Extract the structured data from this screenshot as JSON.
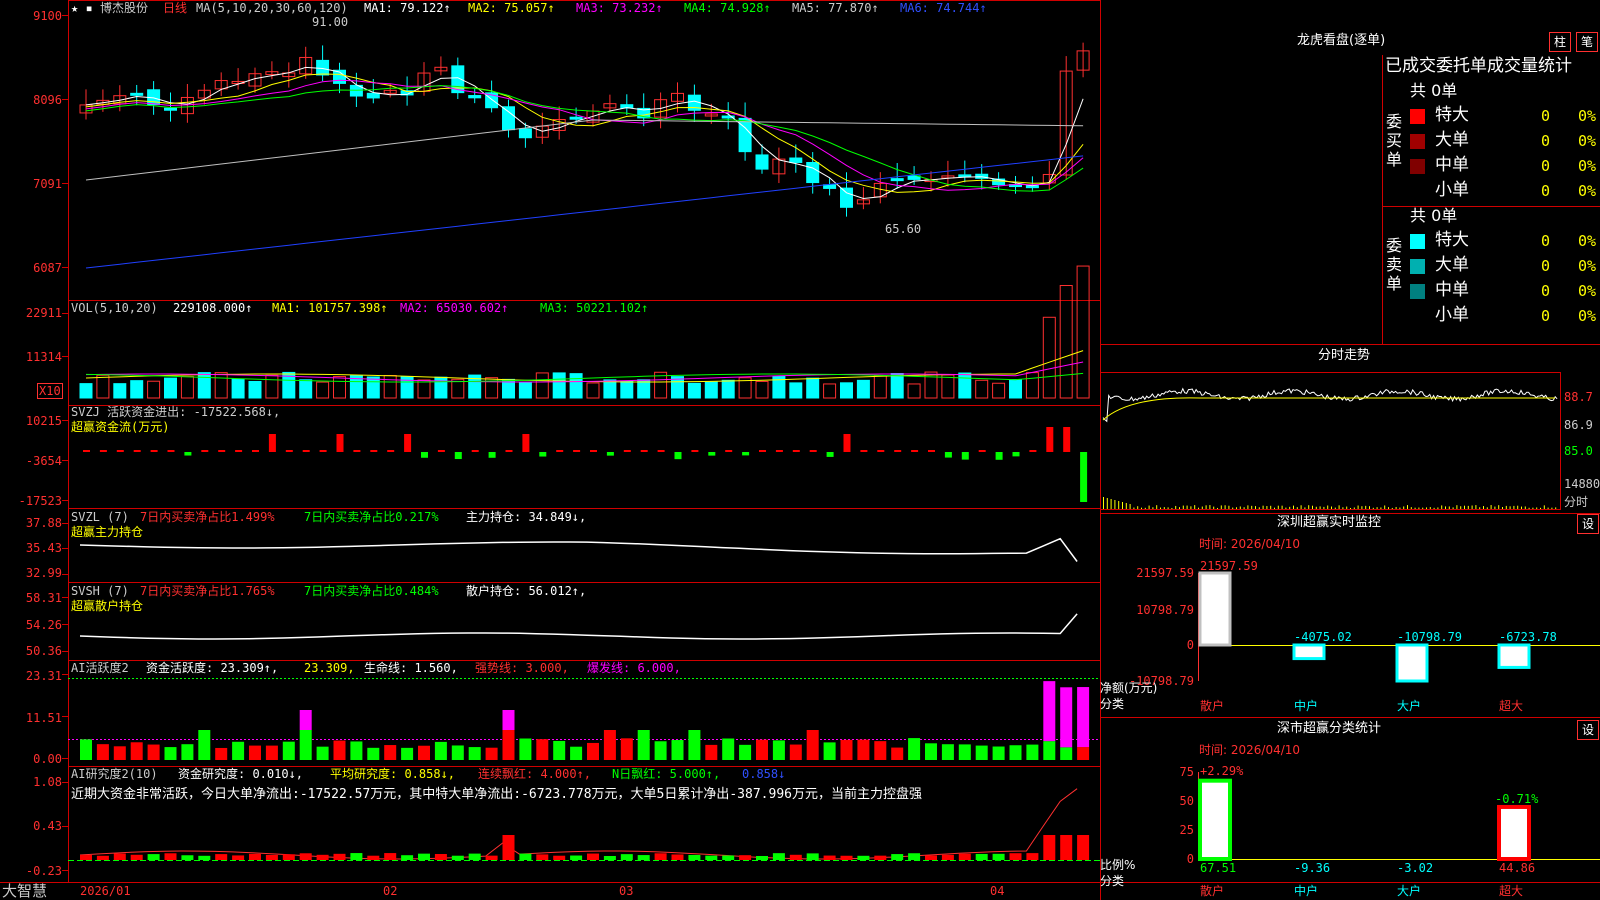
{
  "app": {
    "brand": "大智慧",
    "xlabels": [
      "2026/01",
      "02",
      "03",
      "04"
    ]
  },
  "main": {
    "stock": "博杰股份",
    "period": "日线",
    "ma_label": "MA(5,10,20,30,60,120)",
    "ma_values": [
      "MA1: 79.122↑",
      "MA2: 75.057↑",
      "MA3: 73.232↑",
      "MA4: 74.928↑",
      "MA5: 77.870↑",
      "MA6: 74.744↑"
    ],
    "y_ticks": [
      "9100",
      "8096",
      "7091",
      "6087"
    ],
    "high_mark": "91.00",
    "low_mark": "65.60"
  },
  "vol": {
    "label": "VOL(5,10,20)",
    "value": "229108.000↑",
    "mas": [
      "MA1: 101757.398↑",
      "MA2: 65030.602↑",
      "MA3: 50221.102↑"
    ],
    "y_ticks": [
      "22911",
      "11314"
    ],
    "unit": "X10"
  },
  "svzj": {
    "label": "SVZJ  活跃资金进出: -17522.568↓,",
    "sub": "超赢资金流(万元)",
    "y_ticks": [
      "10215",
      "-3654",
      "-17523"
    ]
  },
  "svzl": {
    "label": "SVZL (7)",
    "a": "7日内买卖净占比1.499%",
    "b": "7日内买卖净占比0.217%",
    "c": "主力持仓: 34.849↓,",
    "sub": "超赢主力持仓",
    "y_ticks": [
      "37.88",
      "35.43",
      "32.99"
    ]
  },
  "svsh": {
    "label": "SVSH (7)",
    "a": "7日内买卖净占比1.765%",
    "b": "7日内买卖净占比0.484%",
    "c": "散户持仓: 56.012↑,",
    "sub": "超赢散户持仓",
    "y_ticks": [
      "58.31",
      "54.26",
      "50.36"
    ]
  },
  "ai1": {
    "label": "AI活跃度2",
    "a": "资金活跃度: 23.309↑,",
    "b": "23.309,",
    "c": "生命线: 1.560,",
    "d": "强势线: 3.000,",
    "e": "爆发线: 6.000,",
    "y_ticks": [
      "23.31",
      "11.51",
      "0.00"
    ]
  },
  "ai2": {
    "label": "AI研究度2(10)",
    "a": "资金研究度: 0.010↓,",
    "b": "平均研究度: 0.858↓,",
    "c": "连续飘红: 4.000↑,",
    "d": "N日飘红: 5.000↑,",
    "e": "0.858↓",
    "comment": "近期大资金非常活跃，今日大单净流出:-17522.57万元，其中特大单净流出:-6723.778万元，大单5日累计净出-387.996万元，当前主力控盘强",
    "y_ticks": [
      "1.08",
      "0.43",
      "-0.23"
    ]
  },
  "dragon": {
    "title": "龙虎看盘(逐单)",
    "btn1": "柱",
    "btn2": "笔",
    "header": "已成交委托单成交量统计",
    "buy_label": "委买单",
    "sell_label": "委卖单",
    "total": "共 0单",
    "rows": [
      {
        "name": "特大",
        "v": "0",
        "p": "0%"
      },
      {
        "name": "大单",
        "v": "0",
        "p": "0%"
      },
      {
        "name": "中单",
        "v": "0",
        "p": "0%"
      },
      {
        "name": "小单",
        "v": "0",
        "p": "0%"
      }
    ],
    "buy_colors": [
      "#ff0000",
      "#a00000",
      "#800000",
      "#000000"
    ],
    "sell_colors": [
      "#00ffff",
      "#00b0b0",
      "#008080",
      "#000000"
    ]
  },
  "intraday": {
    "title": "分时走势",
    "y_ticks": [
      "88.7",
      "86.9",
      "85.0",
      "14880"
    ],
    "unit": "分时"
  },
  "monitor": {
    "title": "深圳超赢实时监控",
    "btn": "设",
    "time": "时间: 2026/04/10",
    "y_ticks": [
      "21597.59",
      "10798.79",
      "0",
      "-10798.79"
    ],
    "ylabel1": "净额(万元)",
    "ylabel2": "分类",
    "chart_data": {
      "type": "bar",
      "categories": [
        "散户",
        "中户",
        "大户",
        "超大"
      ],
      "values": [
        21597.59,
        -4075.02,
        -10798.79,
        -6723.78
      ],
      "labels": [
        "21597.59",
        "-4075.02",
        "-10798.79",
        "-6723.78"
      ],
      "ylim": [
        -10798.79,
        21597.59
      ],
      "xlabel": "分类",
      "ylabel": "净额(万元)"
    }
  },
  "classify": {
    "title": "深市超赢分类统计",
    "btn": "设",
    "time": "时间: 2026/04/10",
    "y_ticks": [
      "75",
      "50",
      "25",
      "0"
    ],
    "ylabel1": "比例%",
    "ylabel2": "分类",
    "chart_data": {
      "type": "bar",
      "categories": [
        "散户",
        "中户",
        "大户",
        "超大"
      ],
      "values": [
        67.51,
        -9.36,
        -3.02,
        44.86
      ],
      "labels": [
        "67.51",
        "-9.36",
        "-3.02",
        "44.86"
      ],
      "changes": [
        "+2.29%",
        "",
        "",
        "-0.71%"
      ],
      "ylim": [
        0,
        75
      ],
      "xlabel": "分类",
      "ylabel": "比例%"
    }
  }
}
